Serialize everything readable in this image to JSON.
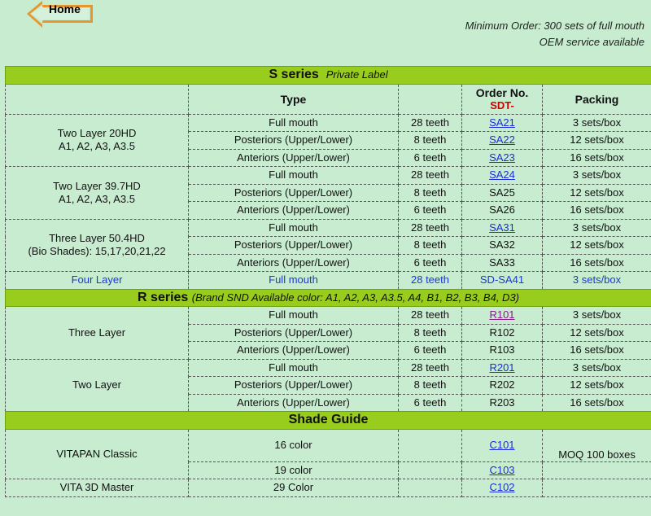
{
  "home": {
    "label": "Home"
  },
  "notes": {
    "line1": "Minimum Order: 300 sets of full mouth",
    "line2": "OEM service available"
  },
  "s_series": {
    "title": "S series",
    "subtitle": "Private Label",
    "headers": {
      "type": "Type",
      "order": "Order No.",
      "order_prefix": "SDT-",
      "packing": "Packing"
    },
    "groups": [
      {
        "name1": "Two Layer 20HD",
        "name2": "A1, A2, A3, A3.5",
        "rows": [
          {
            "type": "Full mouth",
            "teeth": "28 teeth",
            "order": "SA21",
            "link": true,
            "packing": "3 sets/box"
          },
          {
            "type": "Posteriors (Upper/Lower)",
            "teeth": "8 teeth",
            "order": "SA22",
            "link": true,
            "packing": "12 sets/box"
          },
          {
            "type": "Anteriors (Upper/Lower)",
            "teeth": "6 teeth",
            "order": "SA23",
            "link": true,
            "packing": "16 sets/box"
          }
        ]
      },
      {
        "name1": "Two Layer 39.7HD",
        "name2": "A1, A2, A3, A3.5",
        "rows": [
          {
            "type": "Full mouth",
            "teeth": "28 teeth",
            "order": "SA24",
            "link": true,
            "packing": "3 sets/box"
          },
          {
            "type": "Posteriors (Upper/Lower)",
            "teeth": "8 teeth",
            "order": "SA25",
            "link": false,
            "packing": "12 sets/box"
          },
          {
            "type": "Anteriors (Upper/Lower)",
            "teeth": "6 teeth",
            "order": "SA26",
            "link": false,
            "packing": "16 sets/box"
          }
        ]
      },
      {
        "name1": "Three Layer 50.4HD",
        "name2": "(Bio Shades): 15,17,20,21,22",
        "rows": [
          {
            "type": "Full mouth",
            "teeth": "28 teeth",
            "order": "SA31",
            "link": true,
            "packing": "3 sets/box"
          },
          {
            "type": "Posteriors (Upper/Lower)",
            "teeth": "8 teeth",
            "order": "SA32",
            "link": false,
            "packing": "12 sets/box"
          },
          {
            "type": "Anteriors (Upper/Lower)",
            "teeth": "6 teeth",
            "order": "SA33",
            "link": false,
            "packing": "16 sets/box"
          }
        ]
      }
    ],
    "four_layer": {
      "name": "Four Layer",
      "type": "Full mouth",
      "teeth": "28 teeth",
      "order": "SD-SA41",
      "packing": "3 sets/box"
    }
  },
  "r_series": {
    "title": "R series",
    "subtitle": "(Brand SND Available color: A1, A2, A3, A3.5, A4, B1, B2, B3, B4, D3)",
    "groups": [
      {
        "name": "Three Layer",
        "rows": [
          {
            "type": "Full mouth",
            "teeth": "28 teeth",
            "order": "R101",
            "link": true,
            "visited": true,
            "packing": "3 sets/box"
          },
          {
            "type": "Posteriors (Upper/Lower)",
            "teeth": "8 teeth",
            "order": "R102",
            "link": false,
            "packing": "12 sets/box"
          },
          {
            "type": "Anteriors (Upper/Lower)",
            "teeth": "6 teeth",
            "order": "R103",
            "link": false,
            "packing": "16 sets/box"
          }
        ]
      },
      {
        "name": "Two Layer",
        "rows": [
          {
            "type": "Full mouth",
            "teeth": "28 teeth",
            "order": "R201",
            "link": true,
            "packing": "3 sets/box"
          },
          {
            "type": "Posteriors (Upper/Lower)",
            "teeth": "8 teeth",
            "order": "R202",
            "link": false,
            "packing": "12 sets/box"
          },
          {
            "type": "Anteriors (Upper/Lower)",
            "teeth": "6 teeth",
            "order": "R203",
            "link": false,
            "packing": "16 sets/box"
          }
        ]
      }
    ]
  },
  "shade_guide": {
    "title": "Shade Guide",
    "vitapan": {
      "name": "VITAPAN Classic",
      "color16": "16 color",
      "order16": "C101",
      "color19": "19 color",
      "order19": "C103",
      "moq": "MOQ 100 boxes"
    },
    "vita3d": {
      "name": "VITA 3D Master",
      "color": "29 Color",
      "order": "C102"
    }
  },
  "colors": {
    "background": "#c7ecd0",
    "section": "#98cc1d",
    "link": "#1a2fd6",
    "order_prefix": "#d00000"
  }
}
